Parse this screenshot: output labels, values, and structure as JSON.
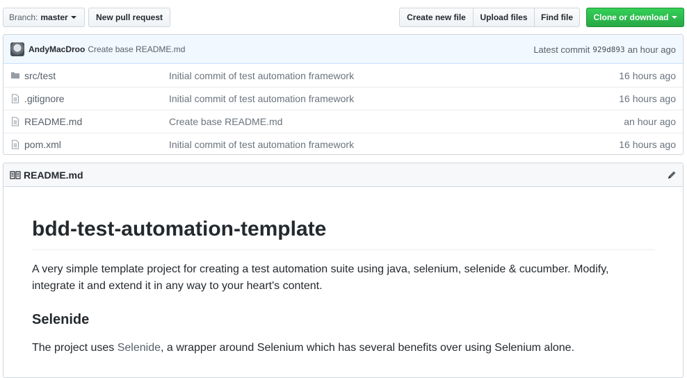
{
  "toolbar": {
    "branch_prefix": "Branch:",
    "branch_name": "master",
    "new_pr": "New pull request",
    "create_file": "Create new file",
    "upload_files": "Upload files",
    "find_file": "Find file",
    "clone": "Clone or download",
    "clone_color": "#28a745"
  },
  "commit": {
    "author": "AndyMacDroo",
    "message": "Create base README.md",
    "latest_label": "Latest commit",
    "sha": "929d893",
    "age": "an hour ago"
  },
  "files": [
    {
      "icon": "folder-icon",
      "name": "src/test",
      "commit": "Initial commit of test automation framework",
      "age": "16 hours ago"
    },
    {
      "icon": "file-icon",
      "name": ".gitignore",
      "commit": "Initial commit of test automation framework",
      "age": "16 hours ago"
    },
    {
      "icon": "file-icon",
      "name": "README.md",
      "commit": "Create base README.md",
      "age": "an hour ago"
    },
    {
      "icon": "file-icon",
      "name": "pom.xml",
      "commit": "Initial commit of test automation framework",
      "age": "16 hours ago"
    }
  ],
  "readme": {
    "header": "README.md",
    "title": "bdd-test-automation-template",
    "intro": "A very simple template project for creating a test automation suite using java, selenium, selenide & cucumber. Modify, integrate it and extend it in any way to your heart's content.",
    "section_title": "Selenide",
    "section_before": "The project uses ",
    "section_link": "Selenide",
    "section_after": ", a wrapper around Selenium which has several benefits over using Selenium alone."
  }
}
